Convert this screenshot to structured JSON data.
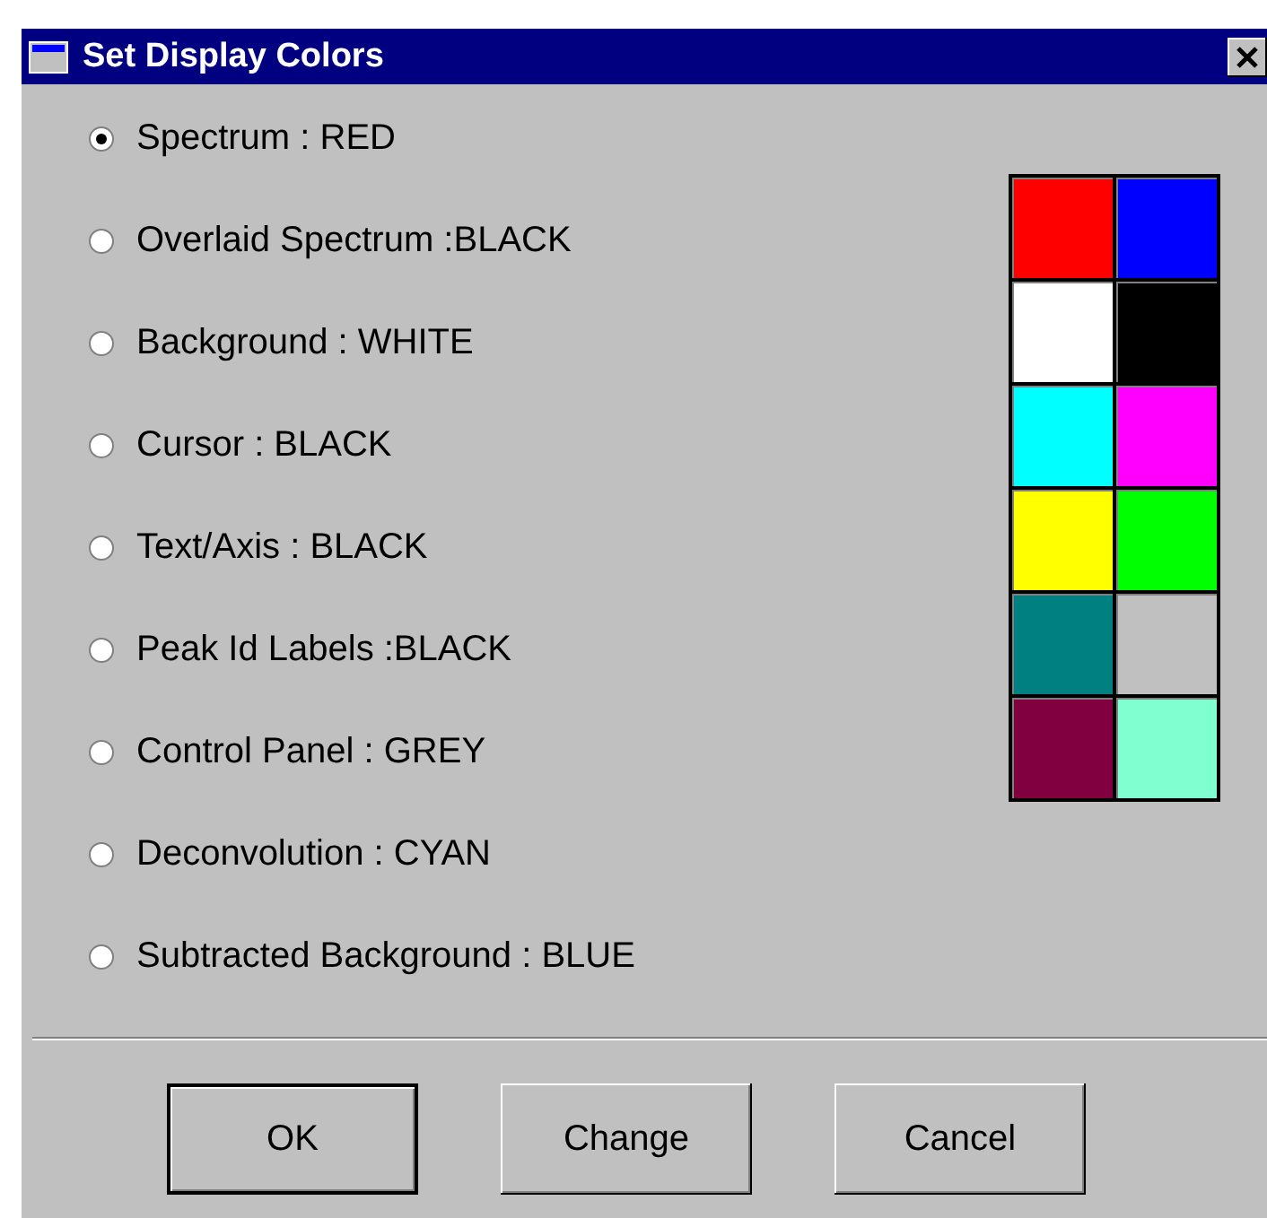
{
  "window": {
    "title": "Set Display Colors"
  },
  "options": [
    {
      "label": "Spectrum : RED",
      "selected": true
    },
    {
      "label": "Overlaid Spectrum :BLACK",
      "selected": false
    },
    {
      "label": "Background : WHITE",
      "selected": false
    },
    {
      "label": "Cursor : BLACK",
      "selected": false
    },
    {
      "label": "Text/Axis : BLACK",
      "selected": false
    },
    {
      "label": "Peak Id Labels :BLACK",
      "selected": false
    },
    {
      "label": "Control Panel : GREY",
      "selected": false
    },
    {
      "label": "Deconvolution : CYAN",
      "selected": false
    },
    {
      "label": "Subtracted Background : BLUE",
      "selected": false
    }
  ],
  "palette": [
    {
      "color": "#ff0000"
    },
    {
      "color": "#0000ff"
    },
    {
      "color": "#ffffff"
    },
    {
      "color": "#000000"
    },
    {
      "color": "#00ffff"
    },
    {
      "color": "#ff00ff"
    },
    {
      "color": "#ffff00"
    },
    {
      "color": "#00ff00"
    },
    {
      "color": "#008080"
    },
    {
      "color": "#c0c0c0"
    },
    {
      "color": "#800040"
    },
    {
      "color": "#80ffd0"
    }
  ],
  "buttons": [
    {
      "label": "OK",
      "default": true
    },
    {
      "label": "Change",
      "default": false
    },
    {
      "label": "Cancel",
      "default": false
    }
  ]
}
